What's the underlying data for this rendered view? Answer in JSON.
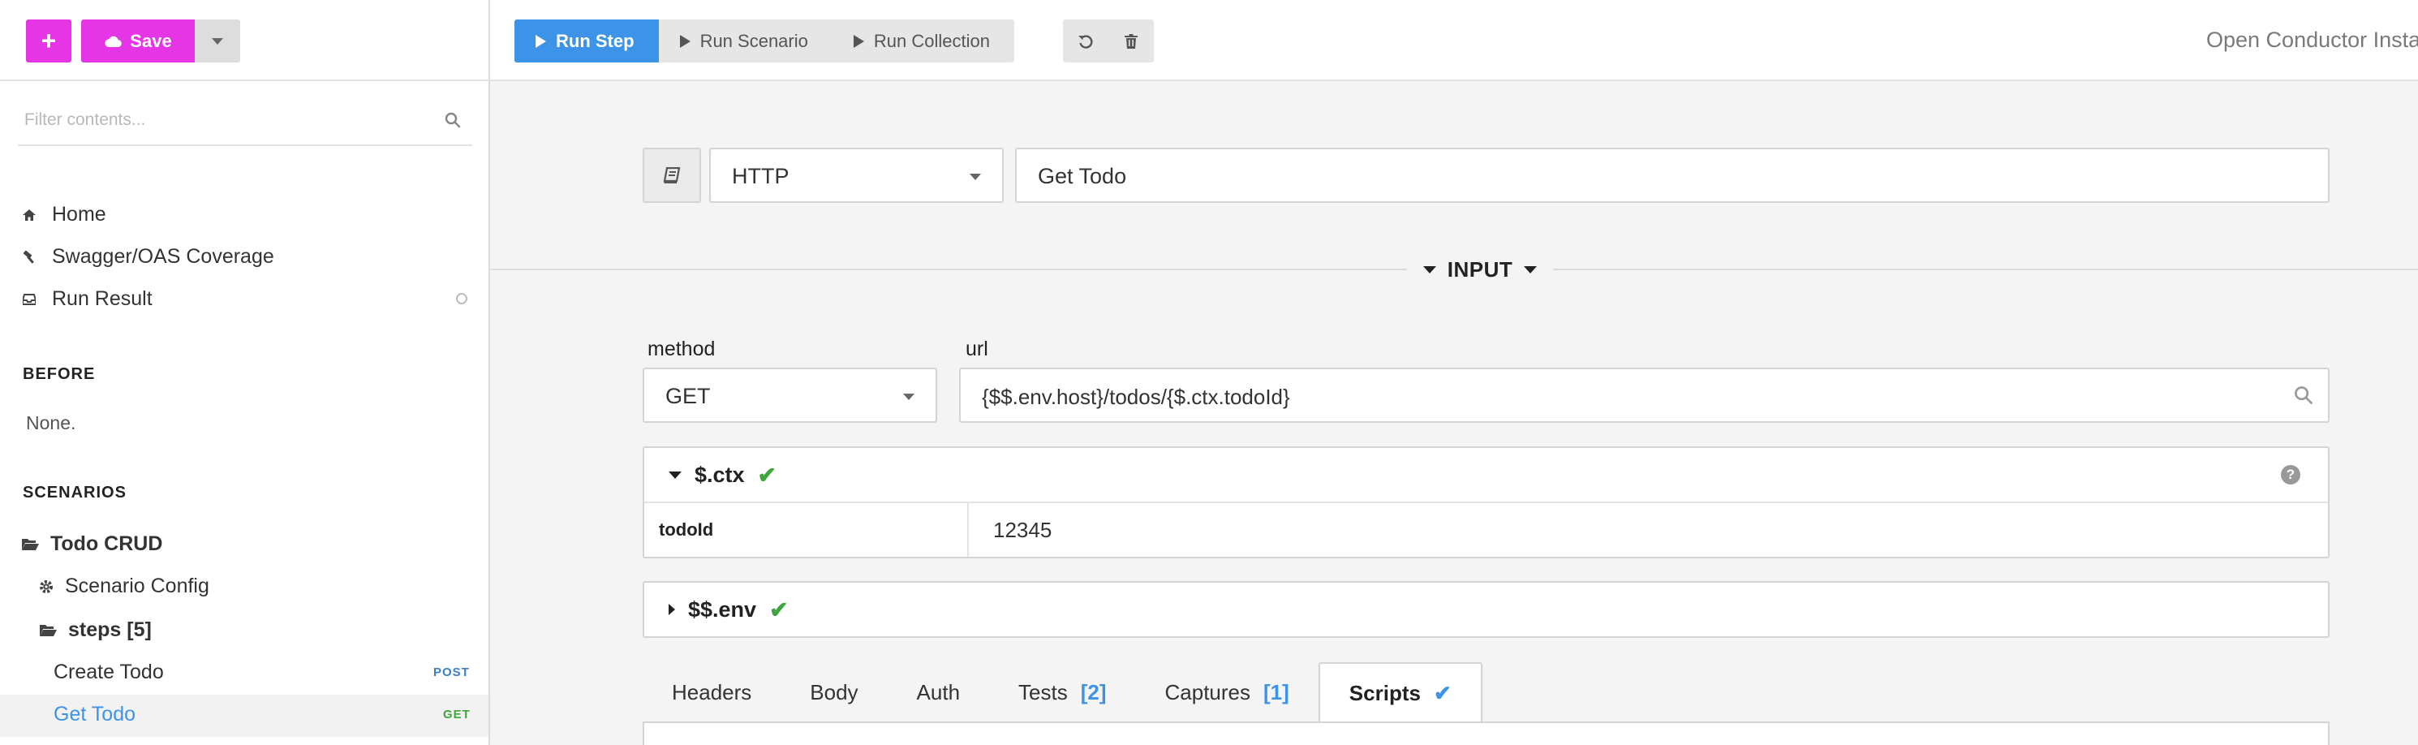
{
  "sidebar": {
    "add_label": "+",
    "save_label": "Save",
    "filter_placeholder": "Filter contents...",
    "nav": [
      {
        "label": "Home",
        "icon": "home-icon"
      },
      {
        "label": "Swagger/OAS Coverage",
        "icon": "hammer-icon"
      },
      {
        "label": "Run Result",
        "icon": "inbox-icon"
      }
    ],
    "before_heading": "BEFORE",
    "before_value": "None.",
    "scenarios_heading": "SCENARIOS",
    "scenario": {
      "name": "Todo CRUD",
      "config_label": "Scenario Config",
      "steps_label": "steps [5]",
      "steps": [
        {
          "label": "Create Todo",
          "method": "POST",
          "method_color": "#3d7fc4"
        },
        {
          "label": "Get Todo",
          "method": "GET",
          "method_color": "#3fa63f",
          "active": true
        }
      ]
    }
  },
  "toolbar": {
    "run_step": "Run Step",
    "run_scenario": "Run Scenario",
    "run_collection": "Run Collection",
    "instance_title": "Open Conductor Insta"
  },
  "step": {
    "type": "HTTP",
    "name": "Get Todo"
  },
  "input": {
    "heading": "INPUT",
    "method_label": "method",
    "method_value": "GET",
    "url_label": "url",
    "url_value": "{$$.env.host}/todos/{$.ctx.todoId}",
    "ctx": {
      "title": "$.ctx",
      "help": "?",
      "rows": [
        {
          "key": "todoId",
          "value": "12345"
        }
      ]
    },
    "env": {
      "title": "$$.env"
    }
  },
  "tabs": [
    {
      "label": "Headers"
    },
    {
      "label": "Body"
    },
    {
      "label": "Auth"
    },
    {
      "label": "Tests",
      "count": "[2]"
    },
    {
      "label": "Captures",
      "count": "[1]"
    },
    {
      "label": "Scripts",
      "active": true
    }
  ],
  "colors": {
    "accent_magenta": "#e535e5",
    "primary_blue": "#3d93e8",
    "success_green": "#3fa63f"
  }
}
